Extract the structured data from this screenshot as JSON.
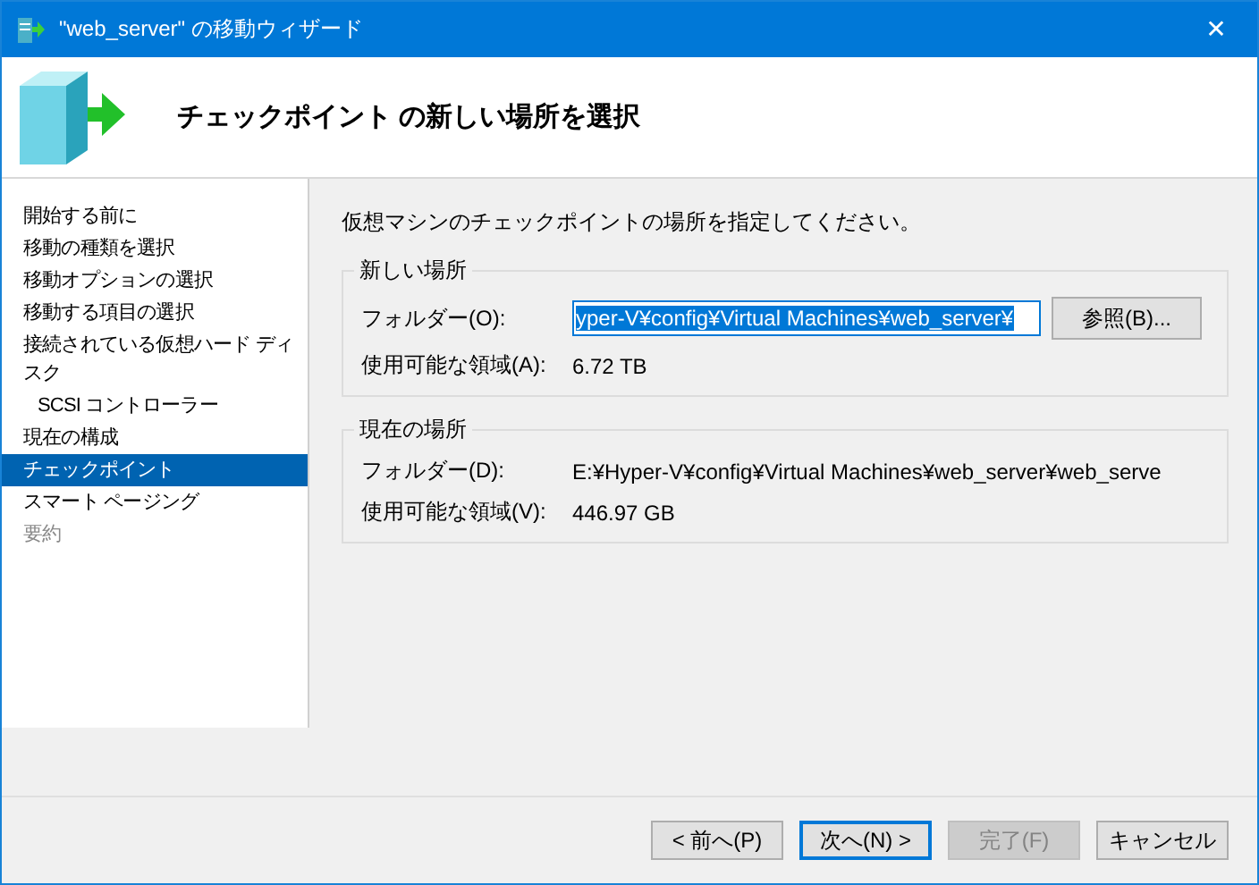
{
  "window": {
    "title": "\"web_server\" の移動ウィザード",
    "close": "✕"
  },
  "header": {
    "title": "チェックポイント の新しい場所を選択"
  },
  "sidebar": {
    "items": [
      {
        "label": "開始する前に",
        "selected": false,
        "disabled": false
      },
      {
        "label": "移動の種類を選択",
        "selected": false,
        "disabled": false
      },
      {
        "label": "移動オプションの選択",
        "selected": false,
        "disabled": false
      },
      {
        "label": "移動する項目の選択",
        "selected": false,
        "disabled": false
      },
      {
        "label": "接続されている仮想ハード ディスク",
        "selected": false,
        "disabled": false,
        "children": [
          {
            "label": "SCSI コントローラー",
            "selected": false,
            "disabled": false
          }
        ]
      },
      {
        "label": "現在の構成",
        "selected": false,
        "disabled": false
      },
      {
        "label": "チェックポイント",
        "selected": true,
        "disabled": false
      },
      {
        "label": "スマート ページング",
        "selected": false,
        "disabled": false
      },
      {
        "label": "要約",
        "selected": false,
        "disabled": true
      }
    ]
  },
  "content": {
    "instruction": "仮想マシンのチェックポイントの場所を指定してください。",
    "new_location": {
      "title": "新しい場所",
      "folder_label": "フォルダー(O):",
      "folder_value": "yper-V¥config¥Virtual Machines¥web_server¥",
      "value_selected": true,
      "browse_button": "参照(B)...",
      "space_label": "使用可能な領域(A):",
      "space_value": "6.72 TB"
    },
    "current_location": {
      "title": "現在の場所",
      "folder_label": "フォルダー(D):",
      "folder_value": "E:¥Hyper-V¥config¥Virtual Machines¥web_server¥web_serve",
      "space_label": "使用可能な領域(V):",
      "space_value": "446.97 GB"
    }
  },
  "buttons": [
    {
      "label": "< 前へ(P)",
      "default": false,
      "disabled": false
    },
    {
      "label": "次へ(N) >",
      "default": true,
      "disabled": false
    },
    {
      "label": "完了(F)",
      "default": false,
      "disabled": true
    },
    {
      "label": "キャンセル",
      "default": false,
      "disabled": false
    }
  ]
}
